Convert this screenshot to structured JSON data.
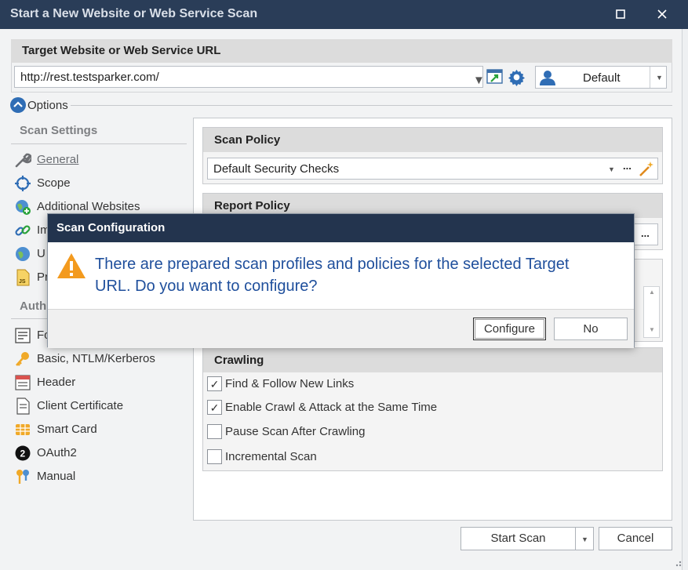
{
  "window": {
    "title": "Start a New Website or Web Service Scan",
    "maximize_glyph": "☐",
    "close_glyph": "✕"
  },
  "target": {
    "header": "Target Website or Web Service URL",
    "url": "http://rest.testsparker.com/",
    "profile": "Default"
  },
  "options": {
    "label": "Options"
  },
  "sidebar": {
    "scan_settings_heading": "Scan Settings",
    "scan_items": [
      {
        "label": "General",
        "icon": "wrench-icon"
      },
      {
        "label": "Scope",
        "icon": "target-icon"
      },
      {
        "label": "Additional Websites",
        "icon": "globe-add-icon"
      },
      {
        "label": "Im",
        "icon": "link-icon"
      },
      {
        "label": "U",
        "icon": "globe-icon"
      },
      {
        "label": "Pr",
        "icon": "js-file-icon"
      }
    ],
    "auth_heading": "Auth",
    "auth_items": [
      {
        "label": "Fo",
        "icon": "form-icon"
      },
      {
        "label": "Basic, NTLM/Kerberos",
        "icon": "key-icon"
      },
      {
        "label": "Header",
        "icon": "header-icon"
      },
      {
        "label": "Client Certificate",
        "icon": "certificate-icon"
      },
      {
        "label": "Smart Card",
        "icon": "smart-card-icon"
      },
      {
        "label": "OAuth2",
        "icon": "oauth2-icon"
      },
      {
        "label": "Manual",
        "icon": "manual-keys-icon"
      }
    ]
  },
  "scan_policy": {
    "header": "Scan Policy",
    "value": "Default Security Checks",
    "more": "..."
  },
  "report_policy": {
    "header": "Report Policy",
    "more": "..."
  },
  "crawling": {
    "header": "Crawling",
    "options": [
      {
        "label": "Find & Follow New Links",
        "checked": true
      },
      {
        "label": "Enable Crawl & Attack at the Same Time",
        "checked": true
      },
      {
        "label": "Pause Scan After Crawling",
        "checked": false
      },
      {
        "label": "Incremental Scan",
        "checked": false
      }
    ]
  },
  "footer": {
    "start_scan": "Start Scan",
    "cancel": "Cancel"
  },
  "dialog": {
    "title": "Scan Configuration",
    "message": "There are prepared scan profiles and policies for the selected Target URL. Do you want to configure?",
    "configure": "Configure",
    "no": "No"
  },
  "colors": {
    "titlebar": "#2a3d58",
    "dialog_titlebar": "#23344e",
    "dialog_text": "#1f4f9c",
    "warning": "#f39a1e",
    "accent_blue": "#2f6db5"
  }
}
